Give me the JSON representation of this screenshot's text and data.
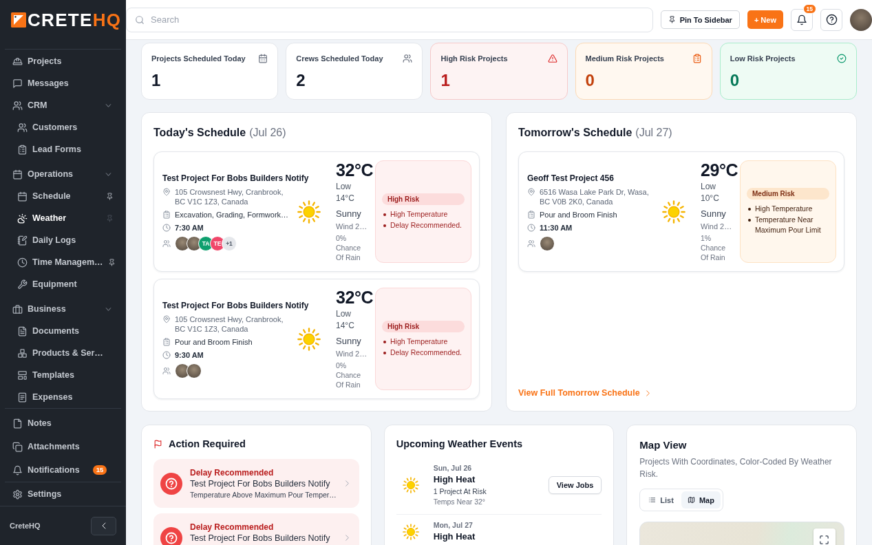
{
  "sidebar": {
    "logo": {
      "text": "CRETE",
      "accent": "HQ"
    },
    "nav": [
      {
        "label": "Projects",
        "selected": false
      },
      {
        "label": "Messages",
        "selected": false
      },
      {
        "label": "CRM",
        "selected": false,
        "expanded": true,
        "children": [
          {
            "label": "Customers",
            "selected": false
          },
          {
            "label": "Lead Forms",
            "selected": false
          }
        ]
      },
      {
        "label": "Operations",
        "selected": false,
        "expanded": true,
        "children": [
          {
            "label": "Schedule",
            "selected": false,
            "pinned": true
          },
          {
            "label": "Weather",
            "selected": true,
            "pinned": false
          },
          {
            "label": "Daily Logs",
            "selected": false
          },
          {
            "label": "Time Managem…",
            "selected": false,
            "pinned": true
          },
          {
            "label": "Equipment",
            "selected": false
          }
        ]
      },
      {
        "label": "Business",
        "selected": false,
        "expanded": true,
        "children": [
          {
            "label": "Documents",
            "selected": false
          },
          {
            "label": "Products & Ser…",
            "selected": false
          },
          {
            "label": "Templates",
            "selected": false
          },
          {
            "label": "Expenses",
            "selected": false
          }
        ]
      }
    ],
    "bottom": [
      {
        "label": "Notes",
        "selected": false
      },
      {
        "label": "Attachments",
        "selected": false
      },
      {
        "label": "Notifications",
        "selected": false,
        "badge": "15"
      }
    ],
    "settings": {
      "label": "Settings",
      "selected": false
    },
    "footer": "CreteHQ"
  },
  "topbar": {
    "search": {
      "placeholder": "Search"
    },
    "pin_button": "Pin To Sidebar",
    "new_button": "+ New",
    "notification_badge": "15"
  },
  "stats": [
    {
      "kind": "projects",
      "label": "Projects Scheduled Today",
      "value": "1"
    },
    {
      "kind": "crews",
      "label": "Crews Scheduled Today",
      "value": "2"
    },
    {
      "kind": "high",
      "label": "High Risk Projects",
      "value": "1"
    },
    {
      "kind": "medium",
      "label": "Medium Risk Projects",
      "value": "0"
    },
    {
      "kind": "low",
      "label": "Low Risk Projects",
      "value": "0"
    }
  ],
  "today": {
    "title": "Today's Schedule",
    "date": "(Jul 26)",
    "jobs": [
      {
        "name": "Test Project For Bobs Builders Notify",
        "address": "105 Crowsnest Hwy, Cranbrook, BC V1C 1Z3, Canada",
        "task": "Excavation, Grading, Formwork…",
        "time": "7:30 AM",
        "crew": [
          {
            "kind": "photo"
          },
          {
            "kind": "photo"
          },
          {
            "kind": "initials",
            "text": "TA",
            "color": "#0e9f6e"
          },
          {
            "kind": "initials",
            "text": "TE",
            "color": "#f0476a"
          },
          {
            "kind": "more",
            "text": "+1"
          }
        ],
        "weather": {
          "temp": "32°C",
          "low": "Low 14°C",
          "condition": "Sunny",
          "wind": "Wind 2…",
          "rain": "0% Chance Of Rain"
        },
        "risk": {
          "kind": "high",
          "label": "High Risk",
          "reasons": [
            "High Temperature",
            "Delay Recommended."
          ]
        }
      },
      {
        "name": "Test Project For Bobs Builders Notify",
        "address": "105 Crowsnest Hwy, Cranbrook, BC V1C 1Z3, Canada",
        "task": "Pour and Broom Finish",
        "time": "9:30 AM",
        "crew": [
          {
            "kind": "photo"
          },
          {
            "kind": "photo"
          }
        ],
        "weather": {
          "temp": "32°C",
          "low": "Low 14°C",
          "condition": "Sunny",
          "wind": "Wind 2…",
          "rain": "0% Chance Of Rain"
        },
        "risk": {
          "kind": "high",
          "label": "High Risk",
          "reasons": [
            "High Temperature",
            "Delay Recommended."
          ]
        }
      }
    ]
  },
  "tomorrow": {
    "title": "Tomorrow's Schedule",
    "date": "(Jul 27)",
    "jobs": [
      {
        "name": "Geoff Test Project 456",
        "address": "6516 Wasa Lake Park Dr, Wasa, BC V0B 2K0, Canada",
        "task": "Pour and Broom Finish",
        "time": "11:30 AM",
        "crew": [
          {
            "kind": "photo"
          }
        ],
        "weather": {
          "temp": "29°C",
          "low": "Low 10°C",
          "condition": "Sunny",
          "wind": "Wind 2…",
          "rain": "1% Chance Of Rain"
        },
        "risk": {
          "kind": "medium",
          "label": "Medium Risk",
          "reasons": [
            "High Temperature",
            "Temperature Near Maximum Pour Limit"
          ]
        }
      }
    ],
    "link": "View Full Tomorrow Schedule"
  },
  "action_required": {
    "title": "Action Required",
    "items": [
      {
        "status": "Delay Recommended",
        "project": "Test Project For Bobs Builders Notify",
        "detail": "Temperature Above Maximum Pour Temper…"
      },
      {
        "status": "Delay Recommended",
        "project": "Test Project For Bobs Builders Notify"
      }
    ]
  },
  "weather_events": {
    "title": "Upcoming Weather Events",
    "events": [
      {
        "date": "Sun, Jul 26",
        "title": "High Heat",
        "count": "1 Project At Risk",
        "note": "Temps Near 32°",
        "button": "View Jobs"
      },
      {
        "date": "Mon, Jul 27",
        "title": "High Heat"
      }
    ]
  },
  "map": {
    "title": "Map View",
    "subtitle": "Projects With Coordinates, Color-Coded By Weather Risk.",
    "views": [
      {
        "label": "List",
        "selected": false
      },
      {
        "label": "Map",
        "selected": true
      }
    ]
  }
}
